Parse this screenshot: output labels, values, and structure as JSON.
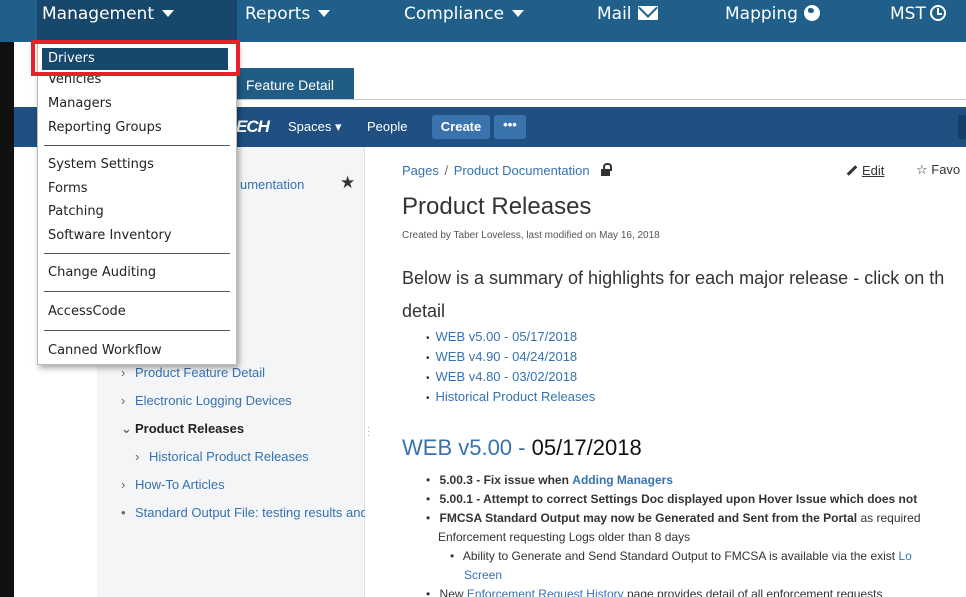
{
  "topnav": {
    "items": [
      {
        "label": "Management",
        "icon": "caret-down-icon"
      },
      {
        "label": "Reports",
        "icon": "caret-down-icon"
      },
      {
        "label": "Compliance",
        "icon": "caret-down-icon"
      },
      {
        "label": "Mail",
        "icon": "envelope-icon"
      },
      {
        "label": "Mapping",
        "icon": "globe-icon"
      },
      {
        "label": "MST",
        "icon": "clock-icon"
      }
    ]
  },
  "dropdown": {
    "items": [
      {
        "label": "Drivers"
      },
      {
        "label": "Vehicles"
      },
      {
        "label": "Managers"
      },
      {
        "label": "Reporting Groups"
      },
      {
        "label": "System Settings"
      },
      {
        "label": "Forms"
      },
      {
        "label": "Patching"
      },
      {
        "label": "Software Inventory"
      },
      {
        "label": "Change Auditing"
      },
      {
        "label": "AccessCode"
      },
      {
        "label": "Canned Workflow"
      }
    ]
  },
  "tab": {
    "label": "Feature Detail"
  },
  "conf_header": {
    "logo": "ECH",
    "spaces": "Spaces ▾",
    "people": "People",
    "create": "Create",
    "more": "•••"
  },
  "sidebar": {
    "space_name": "umentation",
    "tree": [
      {
        "label": "Product Feature Detail",
        "chevron": "›"
      },
      {
        "label": "Electronic Logging Devices",
        "chevron": "›"
      },
      {
        "label": "Product Releases",
        "chevron": "⌄"
      },
      {
        "label": "Historical Product Releases",
        "chevron": "›"
      },
      {
        "label": "How-To Articles",
        "chevron": "›"
      },
      {
        "label": "Standard Output File: testing results and",
        "chevron": "•"
      }
    ]
  },
  "page": {
    "breadcrumb": [
      "Pages",
      "Product Documentation"
    ],
    "breadcrumb_sep": "/",
    "edit": "Edit",
    "favourite": "☆ Favo",
    "title": "Product Releases",
    "meta": "Created by Taber Loveless, last modified on May 16, 2018",
    "intro_line1": "Below is a summary of highlights for each major release - click on th",
    "intro_line2": "detail",
    "release_links": [
      "WEB v5.00 - 05/17/2018",
      "WEB v4.90 - 04/24/2018",
      "WEB v4.80 - 03/02/2018",
      "Historical Product Releases"
    ],
    "section": {
      "link": "WEB v5.00 -",
      "date": " 05/17/2018"
    },
    "changes": {
      "c1_bold": "5.00.3 - Fix issue when",
      "c1_link": "Adding Managers",
      "c2_bold": "5.00.1 - Attempt to correct Settings Doc displayed upon Hover Issue which does not",
      "c3_bold": "FMCSA Standard Output may now be Generated and Sent from the Portal",
      "c3_rest": " as required",
      "c3_line2": "Enforcement requesting Logs older than 8 days",
      "c4_text": "Ability to Generate and Send Standard Output to FMCSA is available via the exist",
      "c4_link": "Lo",
      "c4_line2": "Screen",
      "c5_text": "New",
      "c5_link": "Enforcement Request History",
      "c5_rest": "page provides detail of all enforcement requests"
    }
  },
  "colors": {
    "nav_bg": "#1f5f8a",
    "header_bg": "#205081",
    "link": "#3572b0",
    "highlight": "#e8202a"
  }
}
